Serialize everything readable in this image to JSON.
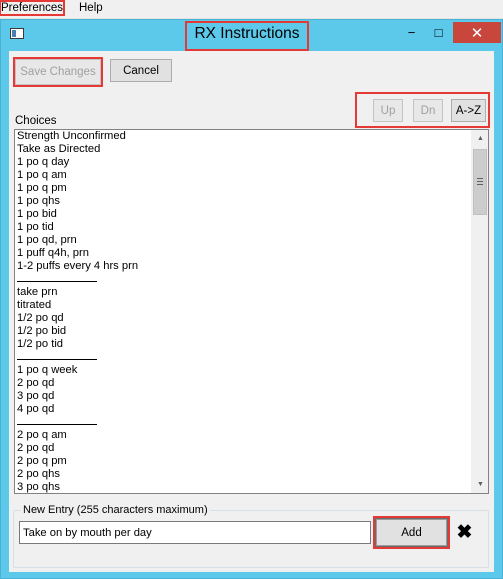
{
  "menubar": {
    "items": [
      "Preferences",
      "Help"
    ]
  },
  "window": {
    "title": "RX Instructions",
    "controls": {
      "minimize": "−",
      "maximize": "□",
      "close": "✕"
    }
  },
  "toolbar": {
    "save_label": "Save Changes",
    "cancel_label": "Cancel"
  },
  "sort_buttons": {
    "up_label": "Up",
    "down_label": "Dn",
    "az_label": "A->Z"
  },
  "choices": {
    "label": "Choices",
    "items": [
      "Strength Unconfirmed",
      "Take as Directed",
      "1 po q day",
      "1 po q am",
      "1 po q pm",
      "1 po qhs",
      "1 po bid",
      "1 po tid",
      "1 po qd, prn",
      "1 puff q4h, prn",
      "1-2 puffs every 4 hrs prn",
      "—",
      "take prn",
      "titrated",
      "1/2 po qd",
      "1/2 po bid",
      "1/2 po tid",
      "—",
      "1 po q week",
      "2 po qd",
      "3 po qd",
      "4 po qd",
      "—",
      "2 po q am",
      "2 po qd",
      "2 po q pm",
      "2 po qhs",
      "3 po qhs"
    ]
  },
  "new_entry": {
    "label": "New Entry (255 characters maximum)",
    "value": "Take on by mouth per day",
    "add_label": "Add",
    "clear_icon": "✖"
  },
  "icons": {
    "app": "window-app-icon",
    "scroll_up": "▲",
    "scroll_down": "▼"
  },
  "colors": {
    "titlebar": "#5cc8ea",
    "close_button": "#c9463d",
    "highlight": "#e53935"
  }
}
